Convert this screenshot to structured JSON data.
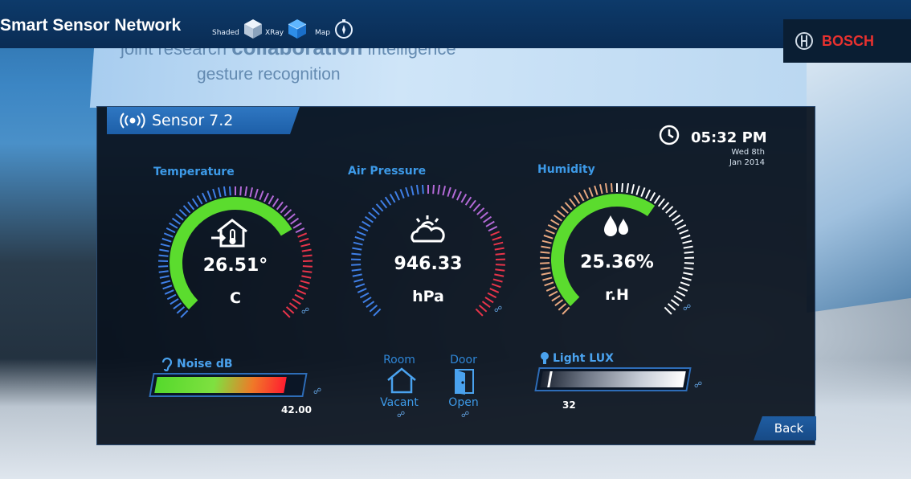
{
  "app": {
    "title": "Smart Sensor Network"
  },
  "toolbar": {
    "views": [
      {
        "label": "Shaded",
        "icon": "cube-shaded-icon"
      },
      {
        "label": "XRay",
        "icon": "cube-xray-icon"
      },
      {
        "label": "Map",
        "icon": "compass-icon"
      }
    ]
  },
  "brand": {
    "name": "BOSCH",
    "color": "#e8312f"
  },
  "background": {
    "line1_pre": "joint research",
    "line1_bold": "collaboration",
    "line1_post": "intelligence",
    "line2": "gesture recognition"
  },
  "sensor": {
    "name": "Sensor 7.2",
    "icon": "signal-broadcast-icon"
  },
  "clock": {
    "time": "05:32 PM",
    "date_line1": "Wed 8th",
    "date_line2": "Jan 2014"
  },
  "gauges": [
    {
      "id": "temperature",
      "label": "Temperature",
      "value": "26.51°",
      "unit": "C",
      "icon": "house-thermometer-icon",
      "level": 0.72
    },
    {
      "id": "pressure",
      "label": "Air Pressure",
      "value": "946.33",
      "unit": "hPa",
      "icon": "sun-cloud-icon",
      "level": 0.0
    },
    {
      "id": "humidity",
      "label": "Humidity",
      "value": "25.36%",
      "unit": "r.H",
      "icon": "water-drops-icon",
      "level": 0.63
    }
  ],
  "noise": {
    "label": "Noise dB",
    "value": "42.00",
    "level": 0.9
  },
  "room": {
    "heading": "Room",
    "status": "Vacant"
  },
  "door": {
    "heading": "Door",
    "status": "Open"
  },
  "light": {
    "label": "Light LUX",
    "value": "32",
    "level": 0.05
  },
  "back": {
    "label": "Back"
  },
  "colors": {
    "accent": "#3d9ae8",
    "gauge_green": "#5bdc2e",
    "tab_blue": "#2f77c2"
  }
}
